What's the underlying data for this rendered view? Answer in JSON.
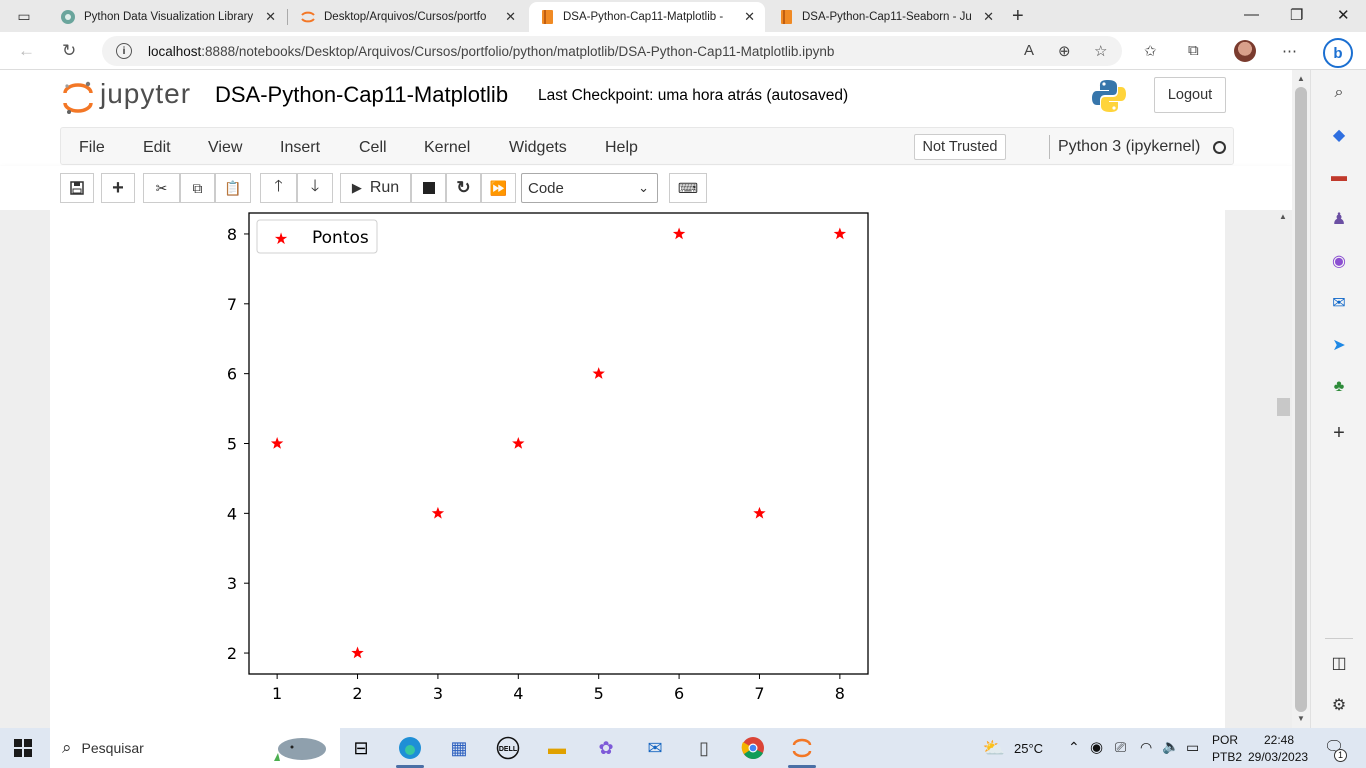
{
  "browser": {
    "tabs": [
      {
        "title": "Python Data Visualization Library",
        "favicon": "seaborn-icon"
      },
      {
        "title": "Desktop/Arquivos/Cursos/portfo",
        "favicon": "jupyter-icon"
      },
      {
        "title": "DSA-Python-Cap11-Matplotlib -",
        "favicon": "notebook-icon",
        "active": true
      },
      {
        "title": "DSA-Python-Cap11-Seaborn - Ju",
        "favicon": "notebook-icon"
      }
    ],
    "url_host": "localhost",
    "url_path": ":8888/notebooks/Desktop/Arquivos/Cursos/portfolio/python/matplotlib/DSA-Python-Cap11-Matplotlib.ipynb"
  },
  "jupyter": {
    "logo_text": "jupyter",
    "notebook_title": "DSA-Python-Cap11-Matplotlib",
    "checkpoint": "Last Checkpoint: uma hora atrás   (autosaved)",
    "logout_label": "Logout",
    "menu": [
      "File",
      "Edit",
      "View",
      "Insert",
      "Cell",
      "Kernel",
      "Widgets",
      "Help"
    ],
    "trust_label": "Not Trusted",
    "kernel_name": "Python 3 (ipykernel)",
    "toolbar": {
      "run_label": "Run",
      "cell_type": "Code"
    }
  },
  "chart_data": {
    "type": "scatter",
    "title": "",
    "xlabel": "",
    "ylabel": "",
    "marker": "*",
    "series": [
      {
        "name": "Pontos",
        "color": "#ff0000",
        "x": [
          1,
          2,
          3,
          4,
          5,
          6,
          7,
          8
        ],
        "y": [
          5,
          2,
          4,
          5,
          6,
          8,
          4,
          8
        ]
      }
    ],
    "xticks": [
      1,
      2,
      3,
      4,
      5,
      6,
      7,
      8
    ],
    "yticks": [
      2,
      3,
      4,
      5,
      6,
      7,
      8
    ],
    "xlim": [
      0.65,
      8.35
    ],
    "ylim": [
      1.7,
      8.3
    ],
    "legend_position": "top-left",
    "grid": false
  },
  "taskbar": {
    "search_placeholder": "Pesquisar",
    "weather": "25°C",
    "language": "POR",
    "layout": "PTB2",
    "time": "22:48",
    "date": "29/03/2023",
    "notification_count": "1"
  }
}
